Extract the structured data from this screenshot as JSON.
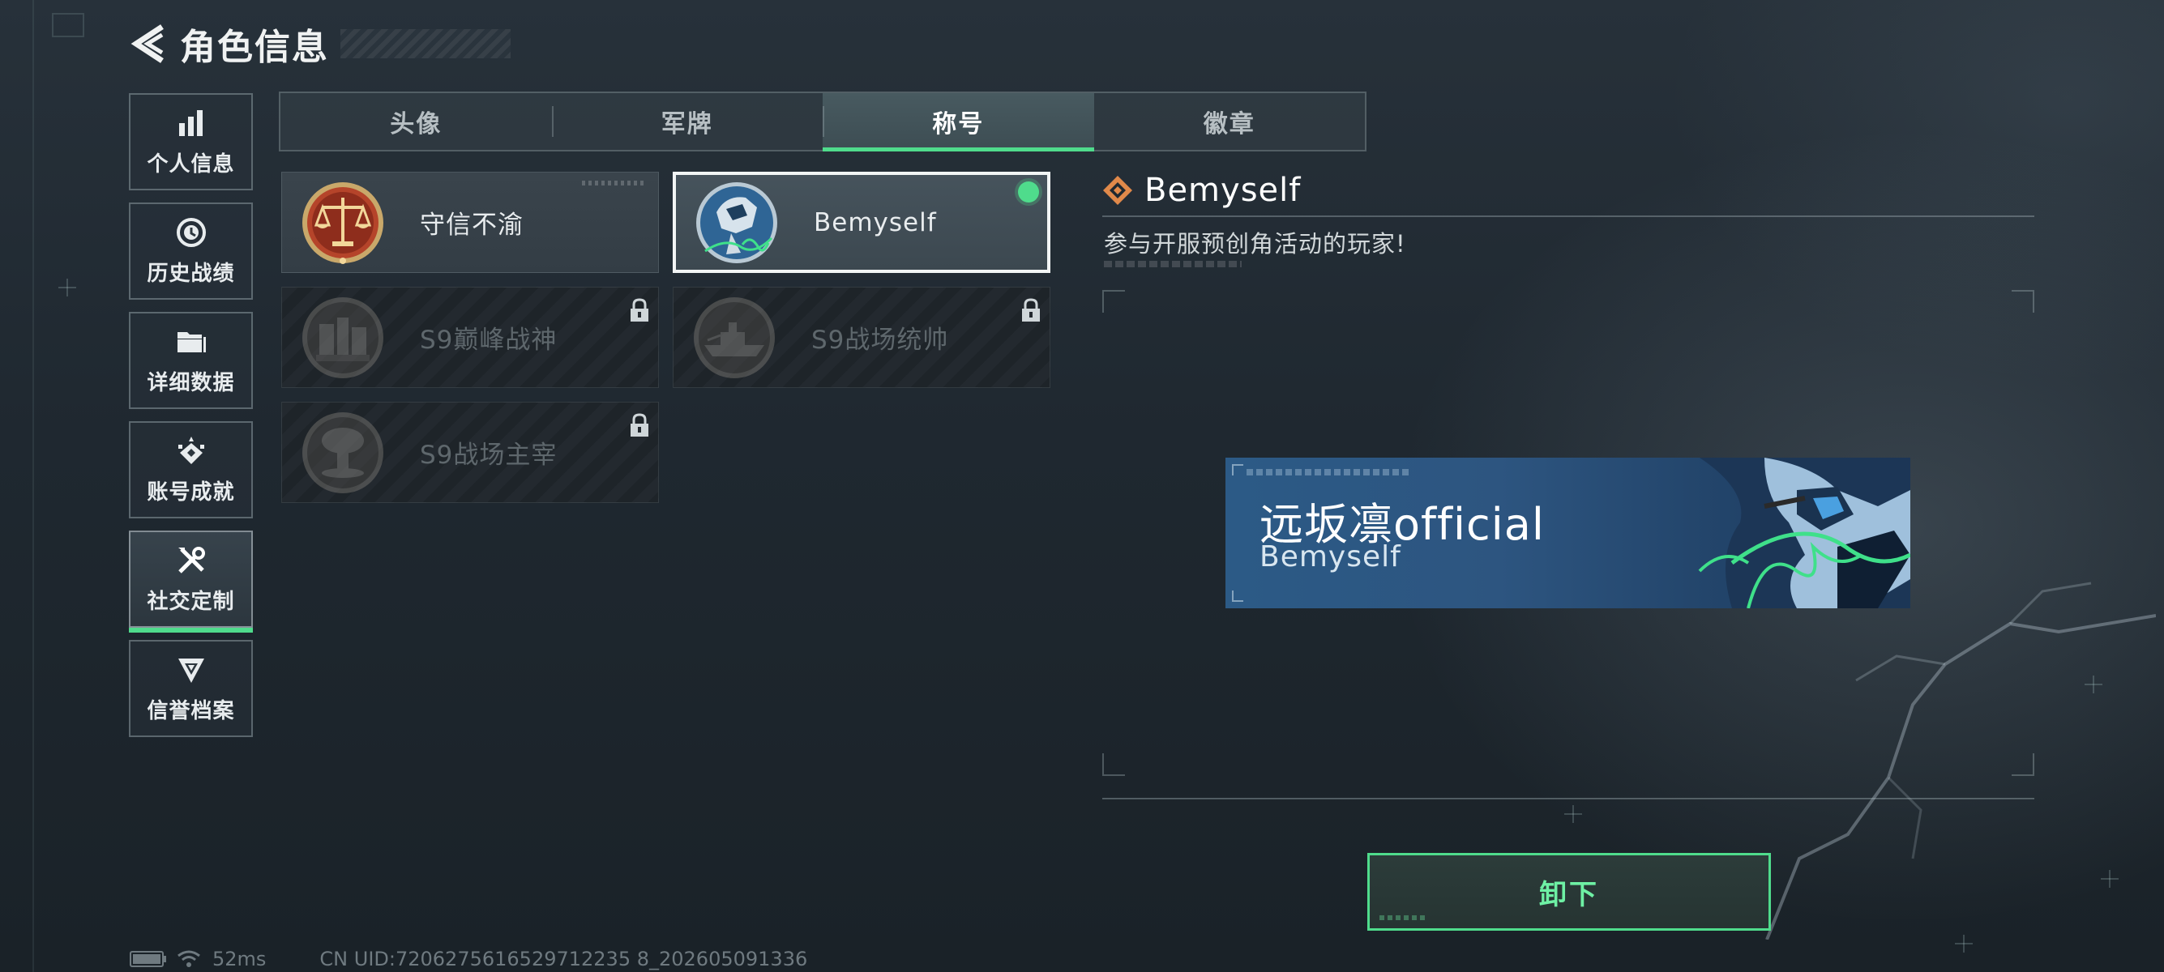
{
  "header": {
    "title": "角色信息",
    "back_icon": "back-arrow-icon"
  },
  "sidebar": {
    "items": [
      {
        "label": "个人信息",
        "icon": "bar-chart-icon",
        "active": false
      },
      {
        "label": "历史战绩",
        "icon": "history-clock-icon",
        "active": false
      },
      {
        "label": "详细数据",
        "icon": "folder-icon",
        "active": false
      },
      {
        "label": "账号成就",
        "icon": "achievement-icon",
        "active": false
      },
      {
        "label": "社交定制",
        "icon": "tools-icon",
        "active": true
      },
      {
        "label": "信誉档案",
        "icon": "reputation-icon",
        "active": false
      }
    ]
  },
  "tabs": [
    {
      "label": "头像",
      "active": false
    },
    {
      "label": "军牌",
      "active": false
    },
    {
      "label": "称号",
      "active": true
    },
    {
      "label": "徽章",
      "active": false
    }
  ],
  "titles": [
    {
      "label": "守信不渝",
      "icon": "scales-medal-icon",
      "locked": false,
      "selected": false
    },
    {
      "label": "Bemyself",
      "icon": "mech-medal-icon",
      "locked": false,
      "selected": true,
      "equipped": true
    },
    {
      "label": "S9巅峰战神",
      "icon": "fortress-medal-icon",
      "locked": true,
      "selected": false
    },
    {
      "label": "S9战场统帅",
      "icon": "warship-medal-icon",
      "locked": true,
      "selected": false
    },
    {
      "label": "S9战场主宰",
      "icon": "mushroom-cloud-medal-icon",
      "locked": true,
      "selected": false
    }
  ],
  "detail": {
    "name": "Bemyself",
    "icon": "diamond-title-icon",
    "description": "参与开服预创角活动的玩家!"
  },
  "banner": {
    "player_name": "远坂凛official",
    "title": "Bemyself"
  },
  "actions": {
    "unequip_label": "卸下"
  },
  "status": {
    "ping": "52ms",
    "uid": "CN UID:7206275616529712235 8_202605091336"
  },
  "colors": {
    "accent": "#4fdc8c",
    "banner_bg": "#2c5a86"
  }
}
